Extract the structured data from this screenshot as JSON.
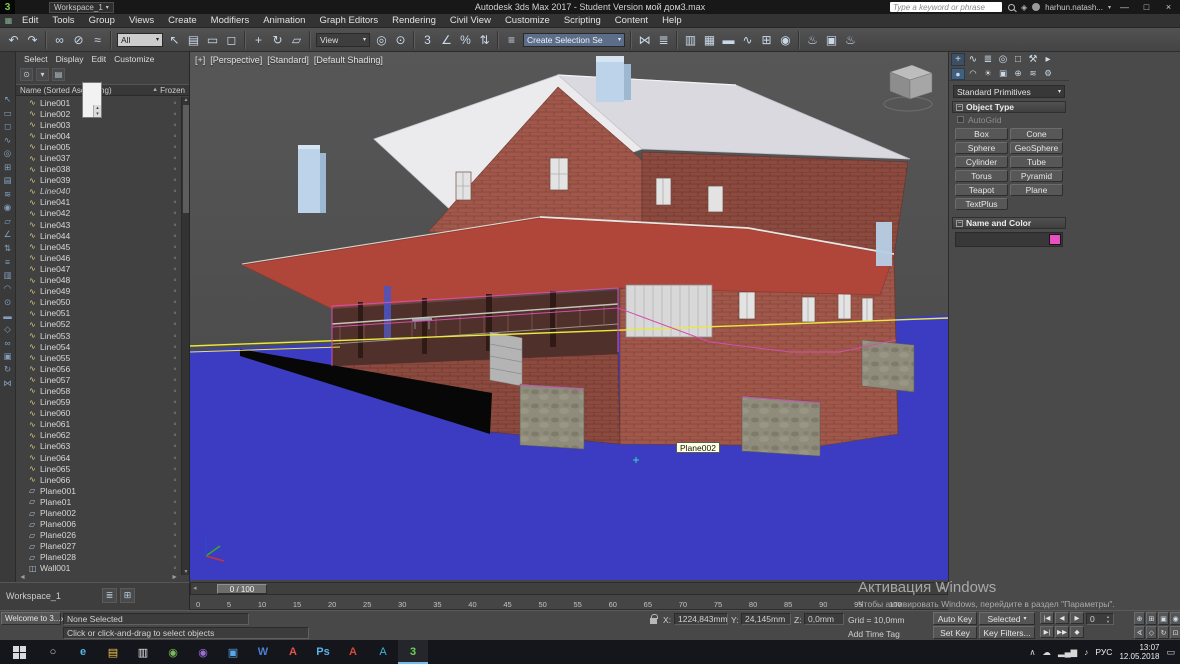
{
  "title_bar": {
    "workspace": "Workspace_1",
    "title": "Autodesk 3ds Max 2017 - Student Version   мой дом3.max",
    "search_placeholder": "Type a keyword or phrase",
    "user": "harhun.natash...",
    "window_controls": {
      "minimize": "—",
      "maximize": "□",
      "close": "×"
    }
  },
  "menubar": {
    "items": [
      "Edit",
      "Tools",
      "Group",
      "Views",
      "Create",
      "Modifiers",
      "Animation",
      "Graph Editors",
      "Rendering",
      "Civil View",
      "Customize",
      "Scripting",
      "Content",
      "Help"
    ]
  },
  "toolbar": {
    "items": [
      {
        "kind": "icon",
        "name": "undo-icon",
        "glyph": "↶"
      },
      {
        "kind": "icon",
        "name": "redo-icon",
        "glyph": "↷"
      },
      {
        "kind": "divider"
      },
      {
        "kind": "icon",
        "name": "select-and-link-icon",
        "glyph": "∞"
      },
      {
        "kind": "icon",
        "name": "unlink-selection-icon",
        "glyph": "⊘"
      },
      {
        "kind": "icon",
        "name": "bind-to-space-warp-icon",
        "glyph": "≈"
      },
      {
        "kind": "divider"
      },
      {
        "kind": "dropdown",
        "name": "selection-filter-dropdown",
        "value": "All"
      },
      {
        "kind": "icon",
        "name": "select-object-icon",
        "glyph": "↖"
      },
      {
        "kind": "icon",
        "name": "select-by-name-icon",
        "glyph": "▤"
      },
      {
        "kind": "icon",
        "name": "rectangular-selection-region-icon",
        "glyph": "▭"
      },
      {
        "kind": "icon",
        "name": "window-crossing-toggle-icon",
        "glyph": "◻"
      },
      {
        "kind": "divider"
      },
      {
        "kind": "icon",
        "name": "select-and-move-icon",
        "glyph": "+"
      },
      {
        "kind": "icon",
        "name": "select-and-rotate-icon",
        "glyph": "↻"
      },
      {
        "kind": "icon",
        "name": "select-and-scale-icon",
        "glyph": "▱"
      },
      {
        "kind": "divider"
      },
      {
        "kind": "dropdown",
        "name": "reference-coordinate-system-dropdown",
        "value": "View"
      },
      {
        "kind": "icon",
        "name": "use-pivot-point-center-icon",
        "glyph": "◎"
      },
      {
        "kind": "icon",
        "name": "select-and-manipulate-icon",
        "glyph": "⊙"
      },
      {
        "kind": "divider"
      },
      {
        "kind": "icon",
        "name": "snaps-toggle-icon",
        "glyph": "3"
      },
      {
        "kind": "icon",
        "name": "angle-snap-toggle-icon",
        "glyph": "∠"
      },
      {
        "kind": "icon",
        "name": "percent-snap-toggle-icon",
        "glyph": "%"
      },
      {
        "kind": "icon",
        "name": "spinner-snap-toggle-icon",
        "glyph": "⇅"
      },
      {
        "kind": "divider"
      },
      {
        "kind": "icon",
        "name": "edit-named-selection-sets-icon",
        "glyph": "≡"
      },
      {
        "kind": "dropdown",
        "name": "named-selection-sets-dropdown",
        "value": "Create Selection Se"
      },
      {
        "kind": "divider"
      },
      {
        "kind": "icon",
        "name": "mirror-icon",
        "glyph": "⋈"
      },
      {
        "kind": "icon",
        "name": "align-icon",
        "glyph": "≣"
      },
      {
        "kind": "divider"
      },
      {
        "kind": "icon",
        "name": "toggle-scene-explorer-icon",
        "glyph": "▥"
      },
      {
        "kind": "icon",
        "name": "toggle-layer-explorer-icon",
        "glyph": "▦"
      },
      {
        "kind": "icon",
        "name": "toggle-ribbon-icon",
        "glyph": "▬"
      },
      {
        "kind": "icon",
        "name": "curve-editor-icon",
        "glyph": "∿"
      },
      {
        "kind": "icon",
        "name": "schematic-view-icon",
        "glyph": "⊞"
      },
      {
        "kind": "icon",
        "name": "material-editor-icon",
        "glyph": "◉"
      },
      {
        "kind": "divider"
      },
      {
        "kind": "icon",
        "name": "render-setup-icon",
        "glyph": "♨"
      },
      {
        "kind": "icon",
        "name": "rendered-frame-window-icon",
        "glyph": "▣"
      },
      {
        "kind": "icon",
        "name": "render-production-icon",
        "glyph": "♨"
      }
    ]
  },
  "left_dock": {
    "icons": [
      "↖",
      "▭",
      "◻",
      "∿",
      "◎",
      "⊞",
      "▤",
      "≋",
      "◉",
      "▱",
      "∠",
      "⇅",
      "≡",
      "▥",
      "◠",
      "⊙",
      "▬",
      "◇",
      "∞",
      "▣",
      "↻",
      "⋈"
    ]
  },
  "explorer": {
    "menu": [
      "Select",
      "Display",
      "Edit",
      "Customize"
    ],
    "name_header": "Name (Sorted Ascending)",
    "sort_arrow": "▲",
    "frozen_header": "Frozen",
    "workspace_tab": "Workspace_1",
    "items": [
      {
        "label": "Line001",
        "type": "shape"
      },
      {
        "label": "Line002",
        "type": "shape"
      },
      {
        "label": "Line003",
        "type": "shape"
      },
      {
        "label": "Line004",
        "type": "shape"
      },
      {
        "label": "Line005",
        "type": "shape"
      },
      {
        "label": "Line037",
        "type": "shape"
      },
      {
        "label": "Line038",
        "type": "shape"
      },
      {
        "label": "Line039",
        "type": "shape"
      },
      {
        "label": "Line040",
        "type": "shape",
        "italic": true
      },
      {
        "label": "Line041",
        "type": "shape"
      },
      {
        "label": "Line042",
        "type": "shape"
      },
      {
        "label": "Line043",
        "type": "shape"
      },
      {
        "label": "Line044",
        "type": "shape"
      },
      {
        "label": "Line045",
        "type": "shape"
      },
      {
        "label": "Line046",
        "type": "shape"
      },
      {
        "label": "Line047",
        "type": "shape"
      },
      {
        "label": "Line048",
        "type": "shape"
      },
      {
        "label": "Line049",
        "type": "shape"
      },
      {
        "label": "Line050",
        "type": "shape"
      },
      {
        "label": "Line051",
        "type": "shape"
      },
      {
        "label": "Line052",
        "type": "shape"
      },
      {
        "label": "Line053",
        "type": "shape"
      },
      {
        "label": "Line054",
        "type": "shape"
      },
      {
        "label": "Line055",
        "type": "shape"
      },
      {
        "label": "Line056",
        "type": "shape"
      },
      {
        "label": "Line057",
        "type": "shape"
      },
      {
        "label": "Line058",
        "type": "shape"
      },
      {
        "label": "Line059",
        "type": "shape"
      },
      {
        "label": "Line060",
        "type": "shape"
      },
      {
        "label": "Line061",
        "type": "shape"
      },
      {
        "label": "Line062",
        "type": "shape"
      },
      {
        "label": "Line063",
        "type": "shape"
      },
      {
        "label": "Line064",
        "type": "shape"
      },
      {
        "label": "Line065",
        "type": "shape"
      },
      {
        "label": "Line066",
        "type": "shape"
      },
      {
        "label": "Plane001",
        "type": "plane"
      },
      {
        "label": "Plane01",
        "type": "plane"
      },
      {
        "label": "Plane002",
        "type": "plane"
      },
      {
        "label": "Plane006",
        "type": "plane"
      },
      {
        "label": "Plane026",
        "type": "plane"
      },
      {
        "label": "Plane027",
        "type": "plane"
      },
      {
        "label": "Plane028",
        "type": "plane"
      },
      {
        "label": "Wall001",
        "type": "wall"
      }
    ]
  },
  "viewport": {
    "label_segments": [
      "[+]",
      "[Perspective]",
      "[Standard]",
      "[Default Shading]"
    ],
    "tooltip": "Plane002",
    "colors": {
      "ground": "#3c3cc2",
      "selection_yellow": "#e9e93f",
      "wire_magenta": "#d24fae"
    }
  },
  "command_panel": {
    "tabs": [
      {
        "name": "tab-create",
        "glyph": "+",
        "active": true
      },
      {
        "name": "tab-modify",
        "glyph": "∿"
      },
      {
        "name": "tab-hierarchy",
        "glyph": "≣"
      },
      {
        "name": "tab-motion",
        "glyph": "◎"
      },
      {
        "name": "tab-display",
        "glyph": "□"
      },
      {
        "name": "tab-utilities",
        "glyph": "⚒"
      },
      {
        "name": "panel-menu-arrow",
        "glyph": "▸"
      }
    ],
    "categories": [
      {
        "name": "category-geometry",
        "glyph": "●",
        "active": true
      },
      {
        "name": "category-shapes",
        "glyph": "◠"
      },
      {
        "name": "category-lights",
        "glyph": "☀"
      },
      {
        "name": "category-cameras",
        "glyph": "▣"
      },
      {
        "name": "category-helpers",
        "glyph": "⊕"
      },
      {
        "name": "category-space-warps",
        "glyph": "≋"
      },
      {
        "name": "category-systems",
        "glyph": "⚙"
      }
    ],
    "dropdown": "Standard Primitives",
    "object_type_title": "Object Type",
    "autogrid": "AutoGrid",
    "object_type_buttons": [
      "Box",
      "Cone",
      "Sphere",
      "GeoSphere",
      "Cylinder",
      "Tube",
      "Torus",
      "Pyramid",
      "Teapot",
      "Plane",
      "TextPlus"
    ],
    "name_color_title": "Name and Color",
    "object_name_value": "",
    "color_swatch": "#e94fbe"
  },
  "timeline": {
    "slider_label": "0 / 100",
    "ticks": [
      "0",
      "5",
      "10",
      "15",
      "20",
      "25",
      "30",
      "35",
      "40",
      "45",
      "50",
      "55",
      "60",
      "65",
      "70",
      "75",
      "80",
      "85",
      "90",
      "95",
      "100"
    ]
  },
  "status_bar": {
    "welcome_window": "Welcome to 3...",
    "welcome_close": "×",
    "status": "None Selected",
    "prompt": "Click or click-and-drag to select objects",
    "x_label": "X:",
    "x_value": "1224,843mm",
    "y_label": "Y:",
    "y_value": "24,145mm",
    "z_label": "Z:",
    "z_value": "0,0mm",
    "grid": "Grid = 10,0mm",
    "add_time_tag": "Add Time Tag",
    "auto_key": "Auto Key",
    "selected": "Selected",
    "set_key": "Set Key",
    "key_filters": "Key Filters...",
    "frame_spinner": "0",
    "transport_row1": [
      {
        "name": "go-to-start-button",
        "glyph": "|◀"
      },
      {
        "name": "previous-frame-button",
        "glyph": "◀"
      },
      {
        "name": "play-button",
        "glyph": "▶"
      }
    ],
    "transport_row2": [
      {
        "name": "next-frame-button",
        "glyph": "▶|"
      },
      {
        "name": "go-to-end-button",
        "glyph": "▶▶"
      },
      {
        "name": "key-mode-toggle-button",
        "glyph": "◆"
      }
    ],
    "nav": [
      {
        "name": "zoom-icon",
        "glyph": "⊕"
      },
      {
        "name": "zoom-all-icon",
        "glyph": "⊞"
      },
      {
        "name": "zoom-extents-icon",
        "glyph": "▣"
      },
      {
        "name": "zoom-extents-all-icon",
        "glyph": "◉"
      },
      {
        "name": "field-of-view-icon",
        "glyph": "∢"
      },
      {
        "name": "pan-icon",
        "glyph": "◇"
      },
      {
        "name": "orbit-icon",
        "glyph": "↻"
      },
      {
        "name": "maximize-viewport-toggle-icon",
        "glyph": "⊡"
      }
    ]
  },
  "watermark": {
    "line1": "Активация Windows",
    "line2": "Чтобы активировать Windows, перейдите в раздел \"Параметры\"."
  },
  "taskbar": {
    "icons": [
      {
        "name": "taskbar-search-icon",
        "glyph": "○",
        "color": "#cfcfcf"
      },
      {
        "name": "taskbar-edge-icon",
        "glyph": "e",
        "color": "#53b7e8",
        "bold": true
      },
      {
        "name": "taskbar-file-explorer-icon",
        "glyph": "▤",
        "color": "#f2c14e"
      },
      {
        "name": "taskbar-store-icon",
        "glyph": "▥",
        "color": "#e6e6e6"
      },
      {
        "name": "taskbar-chrome-icon",
        "glyph": "◉",
        "color": "#7cb85c"
      },
      {
        "name": "taskbar-app-purple-icon",
        "glyph": "◉",
        "color": "#9a6fd4"
      },
      {
        "name": "taskbar-photos-icon",
        "glyph": "▣",
        "color": "#5aa7e8"
      },
      {
        "name": "taskbar-word-icon",
        "glyph": "W",
        "color": "#4a7fd4",
        "bold": true
      },
      {
        "name": "taskbar-acrobat-icon",
        "glyph": "A",
        "color": "#e25548",
        "bold": true
      },
      {
        "name": "taskbar-photoshop-icon",
        "glyph": "Ps",
        "color": "#5ab3e8",
        "bold": true
      },
      {
        "name": "taskbar-reader-icon",
        "glyph": "A",
        "color": "#d44a3a",
        "bold": true
      },
      {
        "name": "taskbar-autocad-icon",
        "glyph": "A",
        "color": "#3fb6d9"
      },
      {
        "name": "taskbar-3dsmax-icon",
        "glyph": "3",
        "color": "#6fcf5f",
        "bold": true,
        "active": true
      }
    ],
    "tray_icons": [
      {
        "name": "hidden-icons-chevron",
        "glyph": "∧"
      },
      {
        "name": "cloud-icon",
        "glyph": "☁"
      },
      {
        "name": "network-icon",
        "glyph": "▂▄▆"
      },
      {
        "name": "volume-icon",
        "glyph": "♪"
      }
    ],
    "language": "РУС",
    "time": "13:07",
    "date": "12.05.2018",
    "notification_glyph": "▭"
  }
}
